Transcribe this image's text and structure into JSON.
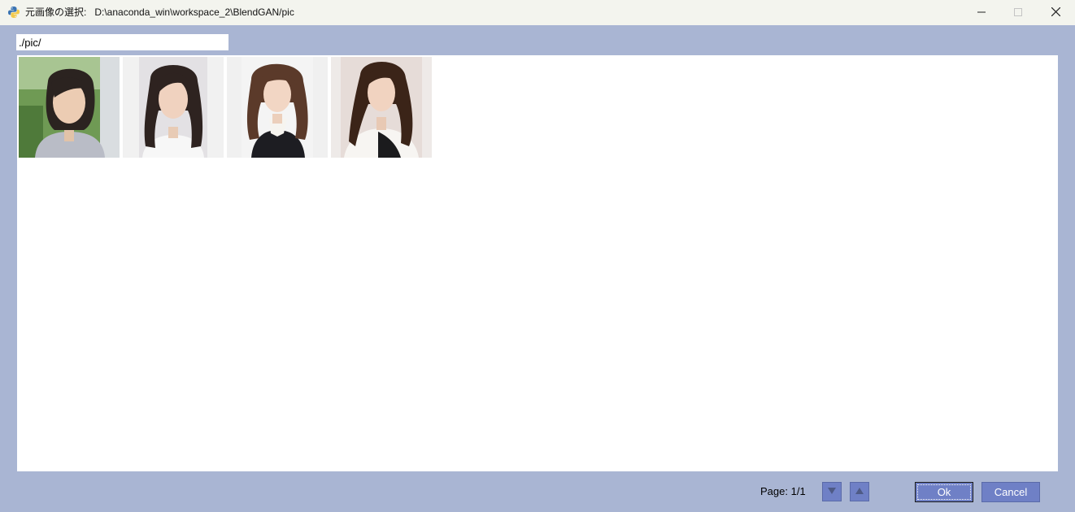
{
  "window": {
    "title": "元画像の選択:",
    "path": "D:\\anaconda_win\\workspace_2\\BlendGAN/pic",
    "app_icon": "python-icon",
    "controls": [
      "minimize-icon",
      "maximize-icon",
      "close-icon"
    ]
  },
  "path_input": {
    "value": "./pic/"
  },
  "gallery": {
    "thumbnails": [
      {
        "name": "portrait-1"
      },
      {
        "name": "portrait-2"
      },
      {
        "name": "portrait-3"
      },
      {
        "name": "portrait-4"
      }
    ]
  },
  "footer": {
    "page_prefix": "Page:",
    "page_value": "1/1",
    "page_down_icon": "triangle-down-icon",
    "page_up_icon": "triangle-up-icon",
    "ok_label": "Ok",
    "cancel_label": "Cancel"
  },
  "colors": {
    "window_bg": "#a9b5d3",
    "titlebar_bg": "#f3f4ee",
    "button_bg": "#6f80c6"
  }
}
